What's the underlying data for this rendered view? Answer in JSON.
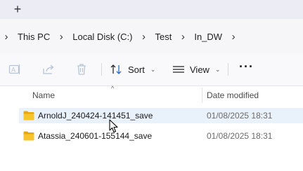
{
  "tabstrip": {
    "new_tab_glyph": "+"
  },
  "breadcrumb": {
    "separator": "›",
    "items": [
      "This PC",
      "Local Disk (C:)",
      "Test",
      "In_DW"
    ]
  },
  "toolbar": {
    "icons": [
      "rename-icon",
      "share-icon",
      "delete-icon"
    ],
    "sort_label": "Sort",
    "view_label": "View",
    "more_glyph": "···",
    "chevron": "⌄"
  },
  "columns": {
    "name": "Name",
    "date_modified": "Date modified",
    "sort_indicator": "^"
  },
  "files": [
    {
      "name": "ArnoldJ_240424-141451_save",
      "date": "01/08/2025 18:31",
      "selected": true
    },
    {
      "name": "Atassia_240601-155144_save",
      "date": "01/08/2025 18:31",
      "selected": false
    }
  ],
  "colors": {
    "folder": "#f8c42e",
    "selection": "#e9f1fb",
    "tabstrip": "#ececf4"
  }
}
